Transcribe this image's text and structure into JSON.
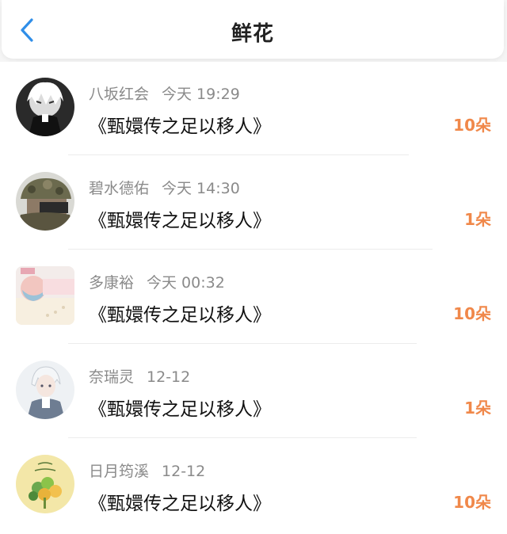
{
  "header": {
    "title": "鲜花",
    "back_icon": "chevron-left-icon",
    "back_color": "#2f8ee8"
  },
  "colors": {
    "count": "#f0884a",
    "meta": "#8a8a8a",
    "title_text": "#111111"
  },
  "items": [
    {
      "user": "八坂红会",
      "time": "今天 19:29",
      "title": "《甄嬛传之足以移人》",
      "count": "10朵",
      "avatar_icon": "anime-avatar-icon"
    },
    {
      "user": "碧水德佑",
      "time": "今天 14:30",
      "title": "《甄嬛传之足以移人》",
      "count": "1朵",
      "avatar_icon": "soldier-avatar-icon"
    },
    {
      "user": "多康裕",
      "time": "今天 00:32",
      "title": "《甄嬛传之足以移人》",
      "count": "10朵",
      "avatar_icon": "baby-avatar-icon"
    },
    {
      "user": "奈瑞灵",
      "time": "12-12",
      "title": "《甄嬛传之足以移人》",
      "count": "1朵",
      "avatar_icon": "white-hair-avatar-icon"
    },
    {
      "user": "日月筠溪",
      "time": "12-12",
      "title": "《甄嬛传之足以移人》",
      "count": "10朵",
      "avatar_icon": "flower-avatar-icon"
    }
  ]
}
